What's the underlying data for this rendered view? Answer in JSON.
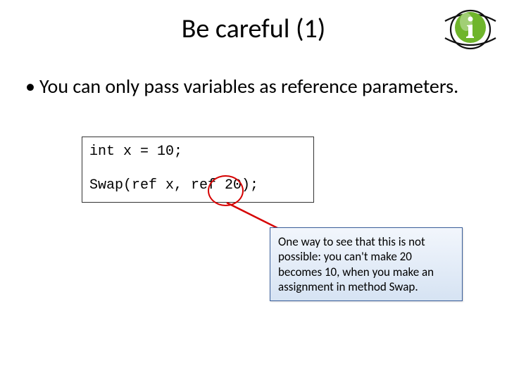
{
  "title": "Be careful (1)",
  "bullet": "You can only pass variables as reference parameters.",
  "code": {
    "line1": "int x = 10;",
    "line2": "Swap(ref x, ref 20);"
  },
  "callout": "One way to see that this is not possible: you can't make 20 becomes 10, when you make an assignment in method Swap.",
  "logo": {
    "accent_color": "#6fb52b",
    "letter": "i"
  },
  "colors": {
    "error_stroke": "#d60000",
    "callout_border": "#3a5e9a"
  }
}
